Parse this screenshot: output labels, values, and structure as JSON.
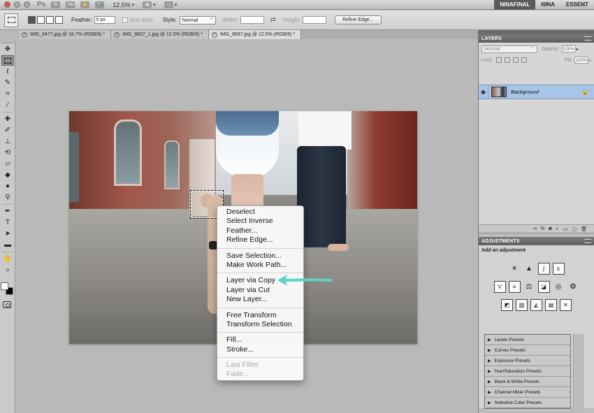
{
  "appbar": {
    "app_logo": "Ps",
    "zoom": "12.5%",
    "workspaces": [
      "NINAFINAL",
      "NINA",
      "ESSENT"
    ]
  },
  "options": {
    "feather_label": "Feather:",
    "feather_value": "0 px",
    "antialias_label": "Anti-alias",
    "style_label": "Style:",
    "style_value": "Normal",
    "width_label": "Width:",
    "height_label": "Height:",
    "refine_edge": "Refine Edge..."
  },
  "tabs": [
    {
      "title": "IMG_9477.jpg @ 16.7% (RGB/8) *",
      "active": false
    },
    {
      "title": "IMG_8837_1.jpg @ 12.5% (RGB/8) *",
      "active": false
    },
    {
      "title": "IMG_8837.jpg @ 12.5% (RGB/8) *",
      "active": true
    }
  ],
  "context_menu": {
    "group1": [
      "Deselect",
      "Select Inverse",
      "Feather...",
      "Refine Edge..."
    ],
    "group2": [
      "Save Selection...",
      "Make Work Path..."
    ],
    "group3": [
      "Layer via Copy",
      "Layer via Cut",
      "New Layer..."
    ],
    "group4": [
      "Free Transform",
      "Transform Selection"
    ],
    "group5": [
      "Fill...",
      "Stroke..."
    ],
    "group6_disabled": [
      "Last Filter",
      "Fade..."
    ]
  },
  "annotation": {
    "arrow_color": "#5fd3c9"
  },
  "layers_panel": {
    "title": "LAYERS",
    "blend_mode": "Normal",
    "opacity_label": "Opacity:",
    "opacity_value": "100%",
    "lock_label": "Lock:",
    "fill_label": "Fill:",
    "fill_value": "100%",
    "layer_name": "Background"
  },
  "adjustments_panel": {
    "title": "ADJUSTMENTS",
    "subtitle": "Add an adjustment",
    "presets": [
      "Levels Presets",
      "Curves Presets",
      "Exposure Presets",
      "Hue/Saturation Presets",
      "Black & White Presets",
      "Channel Mixer Presets",
      "Selective Color Presets"
    ]
  }
}
